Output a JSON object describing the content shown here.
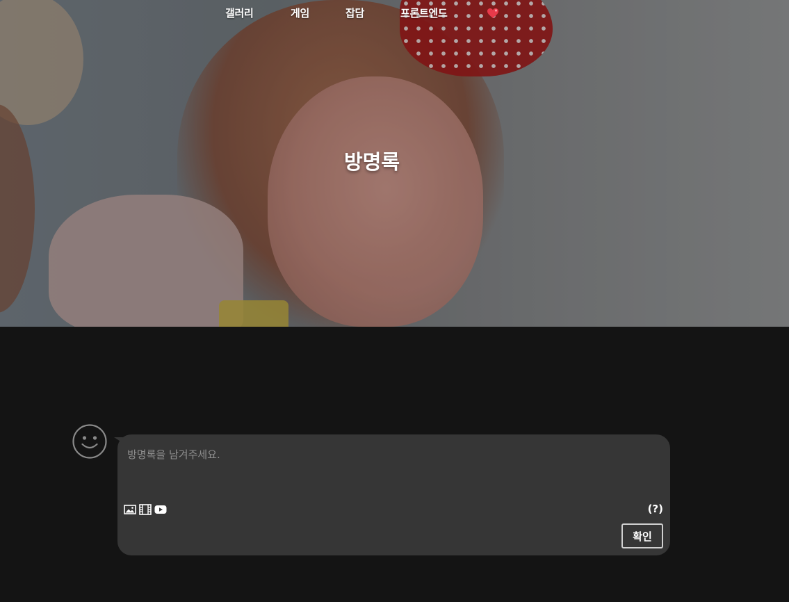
{
  "nav": {
    "items": [
      "갤러리",
      "게임",
      "잡담",
      "프론트엔드"
    ],
    "heart_icon": "heart-icon"
  },
  "header": {
    "title": "방명록"
  },
  "guestbook": {
    "avatar_icon": "smiley-face-icon",
    "placeholder": "방명록을 남겨주세요.",
    "tools": [
      "image-icon",
      "video-icon",
      "youtube-icon"
    ],
    "help_label": "(?)",
    "confirm_label": "확인"
  },
  "colors": {
    "background": "#141414",
    "bubble": "#363636",
    "heart": "#e83a4a"
  }
}
